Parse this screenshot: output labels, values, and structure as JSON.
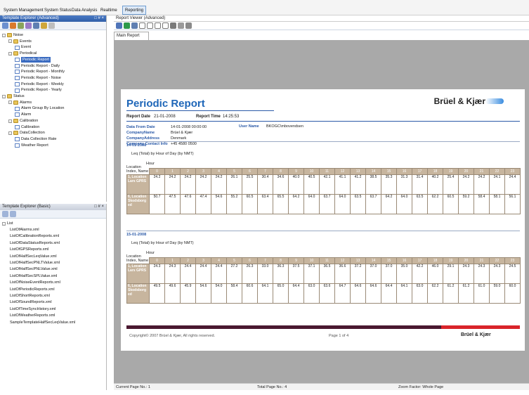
{
  "menu": [
    {
      "label": "System Management",
      "active": false
    },
    {
      "label": "System Status",
      "active": false
    },
    {
      "label": "Data Analysis",
      "active": false
    },
    {
      "label": "Realtime",
      "active": false
    },
    {
      "label": "Reporting",
      "active": true
    }
  ],
  "template_explorer_advanced": {
    "title": "Template Explorer (Advanced)",
    "pin": "□ # ×",
    "tree": [
      {
        "level": 0,
        "label": "Noise",
        "icon": "folder",
        "exp": "-"
      },
      {
        "level": 1,
        "label": "Events",
        "icon": "folder",
        "exp": "-"
      },
      {
        "level": 2,
        "label": "Event",
        "icon": "doc"
      },
      {
        "level": 1,
        "label": "Periodical",
        "icon": "folder",
        "exp": "-"
      },
      {
        "level": 2,
        "label": "Periodic Report",
        "icon": "doc",
        "selected": true
      },
      {
        "level": 2,
        "label": "Periodic Report - Daily",
        "icon": "doc"
      },
      {
        "level": 2,
        "label": "Periodic Report - Monthly",
        "icon": "doc"
      },
      {
        "level": 2,
        "label": "Periodic Report - Noise",
        "icon": "doc"
      },
      {
        "level": 2,
        "label": "Periodic Report - Weekly",
        "icon": "doc"
      },
      {
        "level": 2,
        "label": "Periodic Report - Yearly",
        "icon": "doc"
      },
      {
        "level": 0,
        "label": "Status",
        "icon": "folder",
        "exp": "-"
      },
      {
        "level": 1,
        "label": "Alarms",
        "icon": "folder",
        "exp": "-"
      },
      {
        "level": 2,
        "label": "Alarm Group By Location",
        "icon": "doc"
      },
      {
        "level": 2,
        "label": "Alarm",
        "icon": "doc"
      },
      {
        "level": 1,
        "label": "Calibration",
        "icon": "folder",
        "exp": "-"
      },
      {
        "level": 2,
        "label": "Calibration",
        "icon": "doc"
      },
      {
        "level": 1,
        "label": "DataCollection",
        "icon": "folder",
        "exp": "-"
      },
      {
        "level": 2,
        "label": "Data Collection Rate",
        "icon": "doc"
      },
      {
        "level": 2,
        "label": "Weather Report",
        "icon": "doc"
      }
    ]
  },
  "template_explorer_basic": {
    "title": "Template Explorer (Basic)",
    "pin": "□ # ×",
    "root": "List",
    "files": [
      "ListOfAlarms.xml",
      "ListOfCalibrationReports.xml",
      "ListOfDataStatusReports.xml",
      "ListOfGPSReports.xml",
      "ListOfHalfSecLeqValue.xml",
      "ListOfHalfSecPNLTValue.xml",
      "ListOfHalfSecPNLValue.xml",
      "ListOfHalfSecSPLValue.xml",
      "ListOfNoiseEventReports.xml",
      "ListOfPeriodicReports.xml",
      "ListOfShortReports.xml",
      "ListOfSoundReports.xml",
      "ListOfTimeSyncHistory.xml",
      "ListOfWeatherReports.xml",
      "SampleTemplateHalfSecLeqValue.xml"
    ]
  },
  "report_viewer": {
    "title": "Report Viewer (Advanced)",
    "tab": "Main Report"
  },
  "report": {
    "title": "Periodic Report",
    "brand": "Brüel & Kjær",
    "report_date_label": "Report Date",
    "report_date": "21-01-2008",
    "report_time_label": "Report Time",
    "report_time": "14:25:53",
    "info": [
      {
        "label": "Data From Date",
        "value": "14-01-2008 00:00:00"
      },
      {
        "label": "CompanyName",
        "value": "Brüel & Kjær"
      },
      {
        "label": "CompanyAddress",
        "value": "Denmark"
      },
      {
        "label": "Company Contact Info",
        "value": "+45 4580 0500"
      }
    ],
    "user_label": "User Name",
    "user_value": "BKOGC\\mbovendsen",
    "subtitle": "Leq (Total) by Hour of Day (by NMT)",
    "location_label": "Location",
    "index_label": "Index, Name",
    "hour_label": "Hour",
    "hours": [
      "0",
      "1",
      "2",
      "3",
      "4",
      "5",
      "6",
      "7",
      "8",
      "9",
      "10",
      "11",
      "12",
      "13",
      "14",
      "15",
      "16",
      "17",
      "18",
      "19",
      "20",
      "21",
      "22",
      "23"
    ],
    "sections": [
      {
        "date": "14-01-2008",
        "rows": [
          {
            "loc": "1, Location Lars GPRS",
            "values": [
              "24.2",
              "24.2",
              "24.2",
              "24.2",
              "24.2",
              "26.1",
              "25.5",
              "30.4",
              "34.6",
              "40.0",
              "40.5",
              "42.1",
              "41.1",
              "41.2",
              "38.5",
              "35.3",
              "31.3",
              "31.4",
              "40.2",
              "25.4",
              "24.2",
              "24.2",
              "24.1",
              "24.4"
            ]
          },
          {
            "loc": "6, Location Skodsborg ed",
            "values": [
              "50.7",
              "47.5",
              "47.6",
              "47.4",
              "54.6",
              "55.2",
              "60.5",
              "63.4",
              "65.5",
              "64.2",
              "64.0",
              "63.7",
              "64.0",
              "63.5",
              "63.7",
              "64.2",
              "64.0",
              "63.5",
              "62.2",
              "60.5",
              "59.2",
              "58.4",
              "58.1",
              "56.1"
            ]
          }
        ]
      },
      {
        "date": "15-01-2008",
        "rows": [
          {
            "loc": "1, Location Lars GPRS",
            "values": [
              "24.3",
              "24.3",
              "24.4",
              "24.4",
              "24.4",
              "27.2",
              "26.3",
              "33.0",
              "36.3",
              "37.5",
              "37.1",
              "36.5",
              "36.6",
              "37.2",
              "37.0",
              "37.0",
              "35.0",
              "42.2",
              "46.0",
              "29.1",
              "24.3",
              "24.3",
              "24.3",
              "24.5"
            ]
          },
          {
            "loc": "6, Location Skodsborg ed",
            "values": [
              "49.5",
              "49.6",
              "45.9",
              "54.6",
              "54.0",
              "58.4",
              "60.6",
              "64.1",
              "65.0",
              "64.4",
              "63.0",
              "63.6",
              "64.7",
              "64.6",
              "64.6",
              "64.4",
              "64.1",
              "63.0",
              "62.2",
              "61.2",
              "61.2",
              "61.0",
              "59.0",
              "60.0"
            ]
          }
        ]
      }
    ],
    "footer_copyright": "Copyright© 2007 Brüel & Kjær, All rights reserved.",
    "footer_page": "Page 1 of 4",
    "footer_brand": "Brüel & Kjær"
  },
  "status": {
    "current_page": "Current Page No.: 1",
    "total_page": "Total Page No.: 4",
    "zoom": "Zoom Factor: Whole Page"
  },
  "colors": {
    "title_bar": "#3a6bc0",
    "table_header": "#c7b59e",
    "footer_bar_dark": "#4a1830",
    "footer_bar_red": "#d9242a",
    "report_title": "#1e66b8"
  }
}
